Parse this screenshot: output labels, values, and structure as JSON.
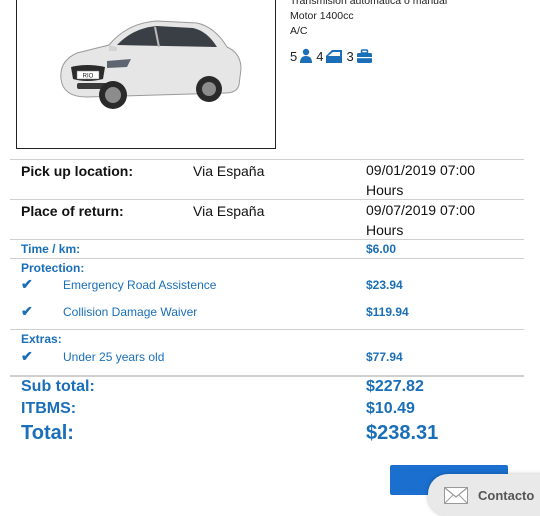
{
  "vehicle": {
    "specs": [
      "Transmisión automática o manual",
      "Motor 1400cc",
      "A/C"
    ],
    "passengers": "5",
    "doors": "4",
    "bags": "3",
    "badge": "RIO"
  },
  "pickup": {
    "label": "Pick up location:",
    "place": "Via España",
    "date": "09/01/2019 07:00 Hours"
  },
  "return": {
    "label": "Place of return:",
    "place": "Via España",
    "date": "09/07/2019 07:00 Hours"
  },
  "time_km": {
    "label": "Time / km:",
    "value": "$6.00"
  },
  "protection": {
    "label": "Protection:",
    "items": [
      {
        "name": "Emergency Road Assistence",
        "price": "$23.94"
      },
      {
        "name": "Collision Damage Waiver",
        "price": "$119.94"
      }
    ]
  },
  "extras": {
    "label": "Extras:",
    "items": [
      {
        "name": "Under 25 years old",
        "price": "$77.94"
      }
    ]
  },
  "summary": {
    "subtotal_label": "Sub total:",
    "subtotal": "$227.82",
    "itbms_label": "ITBMS:",
    "itbms": "$10.49",
    "total_label": "Total:",
    "total": "$238.31"
  },
  "contact": {
    "label": "Contacto"
  },
  "colors": {
    "accent": "#1a6fb8",
    "button": "#1a6fcf"
  },
  "icons": [
    "check-icon",
    "passenger-icon",
    "door-icon",
    "luggage-icon",
    "mail-icon"
  ]
}
